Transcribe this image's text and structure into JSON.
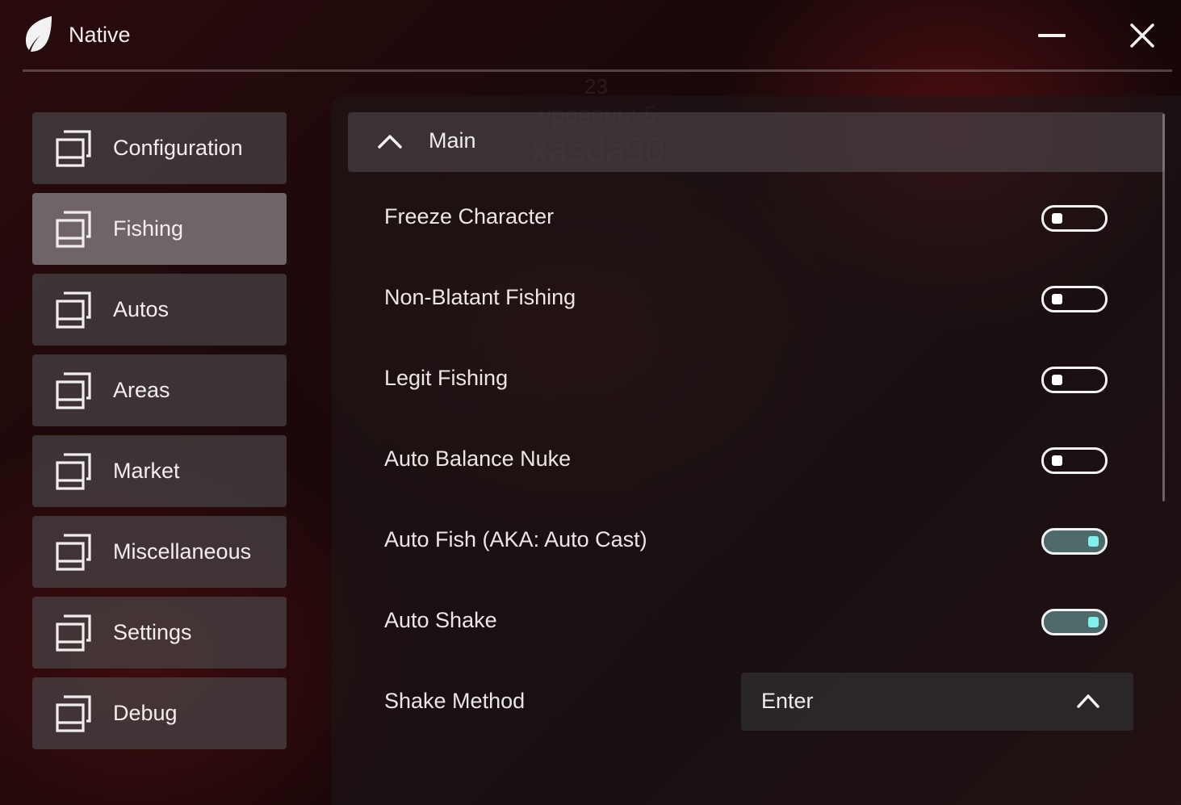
{
  "app": {
    "title": "Native"
  },
  "window_controls": {
    "minimize_icon": "minimize-icon",
    "close_icon": "close-icon"
  },
  "background_overlay": {
    "number": "23",
    "level": "уровень: 5",
    "username": "xasda90"
  },
  "sidebar": {
    "items": [
      {
        "label": "Configuration",
        "icon": "window-stack-icon",
        "active": false
      },
      {
        "label": "Fishing",
        "icon": "window-stack-icon",
        "active": true
      },
      {
        "label": "Autos",
        "icon": "window-stack-icon",
        "active": false
      },
      {
        "label": "Areas",
        "icon": "window-stack-icon",
        "active": false
      },
      {
        "label": "Market",
        "icon": "window-stack-icon",
        "active": false
      },
      {
        "label": "Miscellaneous",
        "icon": "window-stack-icon",
        "active": false
      },
      {
        "label": "Settings",
        "icon": "window-stack-icon",
        "active": false
      },
      {
        "label": "Debug",
        "icon": "window-stack-icon",
        "active": false
      }
    ]
  },
  "main": {
    "section_title": "Main",
    "section_expanded": true,
    "toggles": [
      {
        "label": "Freeze Character",
        "on": false
      },
      {
        "label": "Non-Blatant Fishing",
        "on": false
      },
      {
        "label": "Legit Fishing",
        "on": false
      },
      {
        "label": "Auto Balance Nuke",
        "on": false
      },
      {
        "label": "Auto Fish (AKA: Auto Cast)",
        "on": true
      },
      {
        "label": "Auto Shake",
        "on": true
      }
    ],
    "shake_method": {
      "label": "Shake Method",
      "value": "Enter"
    }
  },
  "colors": {
    "toggle_on_track": "#4e6a6a",
    "toggle_on_knob": "#7ff0ec",
    "sidebar_active": "#807a7c",
    "sidebar_item": "#484446"
  }
}
